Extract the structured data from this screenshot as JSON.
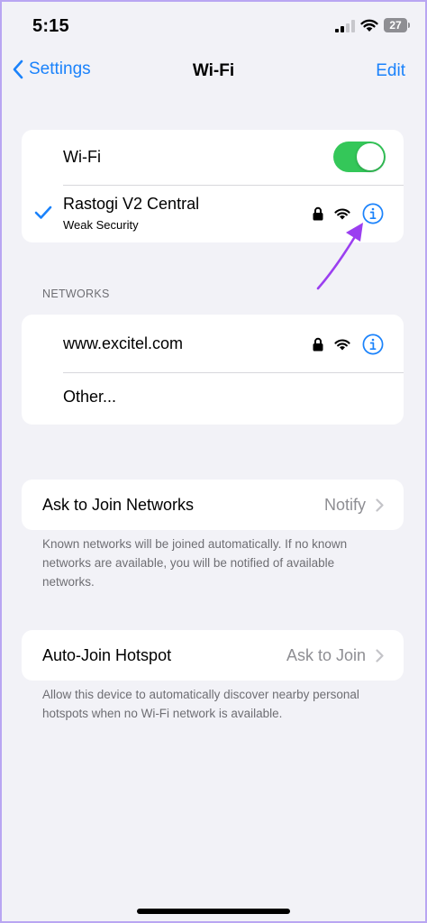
{
  "status_bar": {
    "time": "5:15",
    "battery": "27"
  },
  "nav": {
    "back_label": "Settings",
    "title": "Wi-Fi",
    "edit_label": "Edit"
  },
  "wifi_group": {
    "toggle_label": "Wi-Fi",
    "toggle_on": true,
    "connected_network": {
      "name": "Rastogi V2 Central",
      "subtitle": "Weak Security"
    }
  },
  "networks_section": {
    "header": "NETWORKS",
    "items": [
      {
        "name": "www.excitel.com"
      }
    ],
    "other_label": "Other..."
  },
  "ask_to_join": {
    "label": "Ask to Join Networks",
    "value": "Notify",
    "footer": "Known networks will be joined automatically. If no known networks are available, you will be notified of available networks."
  },
  "auto_join": {
    "label": "Auto-Join Hotspot",
    "value": "Ask to Join",
    "footer": "Allow this device to automatically discover nearby personal hotspots when no Wi-Fi network is available."
  },
  "colors": {
    "accent": "#1a82fb",
    "toggle_on": "#34c759",
    "background": "#f2f2f7",
    "annotation_arrow": "#9b3ff0"
  },
  "icons": [
    "chevron-left-icon",
    "checkmark-icon",
    "lock-icon",
    "wifi-signal-icon",
    "info-icon",
    "chevron-right-icon",
    "cellular-icon",
    "battery-icon"
  ]
}
